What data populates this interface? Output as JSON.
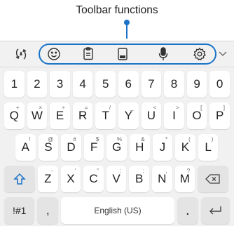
{
  "callout": {
    "label": "Toolbar functions",
    "accent": "#1a73c8"
  },
  "toolbar": {
    "icons": [
      "sync-icon",
      "emoji-icon",
      "clipboard-icon",
      "one-handed-icon",
      "microphone-icon",
      "settings-icon",
      "chevron-down-icon"
    ]
  },
  "keyboard": {
    "number_row": [
      "1",
      "2",
      "3",
      "4",
      "5",
      "6",
      "7",
      "8",
      "9",
      "0"
    ],
    "row1": [
      {
        "k": "Q",
        "s": "+"
      },
      {
        "k": "W",
        "s": "×"
      },
      {
        "k": "E",
        "s": "÷"
      },
      {
        "k": "R",
        "s": "="
      },
      {
        "k": "T",
        "s": "/"
      },
      {
        "k": "Y",
        "s": "_"
      },
      {
        "k": "U",
        "s": "<"
      },
      {
        "k": "I",
        "s": ">"
      },
      {
        "k": "O",
        "s": "["
      },
      {
        "k": "P",
        "s": "]"
      }
    ],
    "row2": [
      {
        "k": "A",
        "s": "!"
      },
      {
        "k": "S",
        "s": "@"
      },
      {
        "k": "D",
        "s": "#"
      },
      {
        "k": "F",
        "s": "$"
      },
      {
        "k": "G",
        "s": "%"
      },
      {
        "k": "H",
        "s": "&"
      },
      {
        "k": "J",
        "s": "*"
      },
      {
        "k": "K",
        "s": "("
      },
      {
        "k": "L",
        "s": ")"
      }
    ],
    "row3": [
      {
        "k": "Z",
        "s": "-"
      },
      {
        "k": "X",
        "s": "'"
      },
      {
        "k": "C",
        "s": "\""
      },
      {
        "k": "V",
        "s": ":"
      },
      {
        "k": "B",
        "s": ";"
      },
      {
        "k": "N",
        "s": ","
      },
      {
        "k": "M",
        "s": "?"
      }
    ],
    "symbols_label": "!#1",
    "comma_label": ",",
    "space_label": "English (US)",
    "period_label": "."
  }
}
